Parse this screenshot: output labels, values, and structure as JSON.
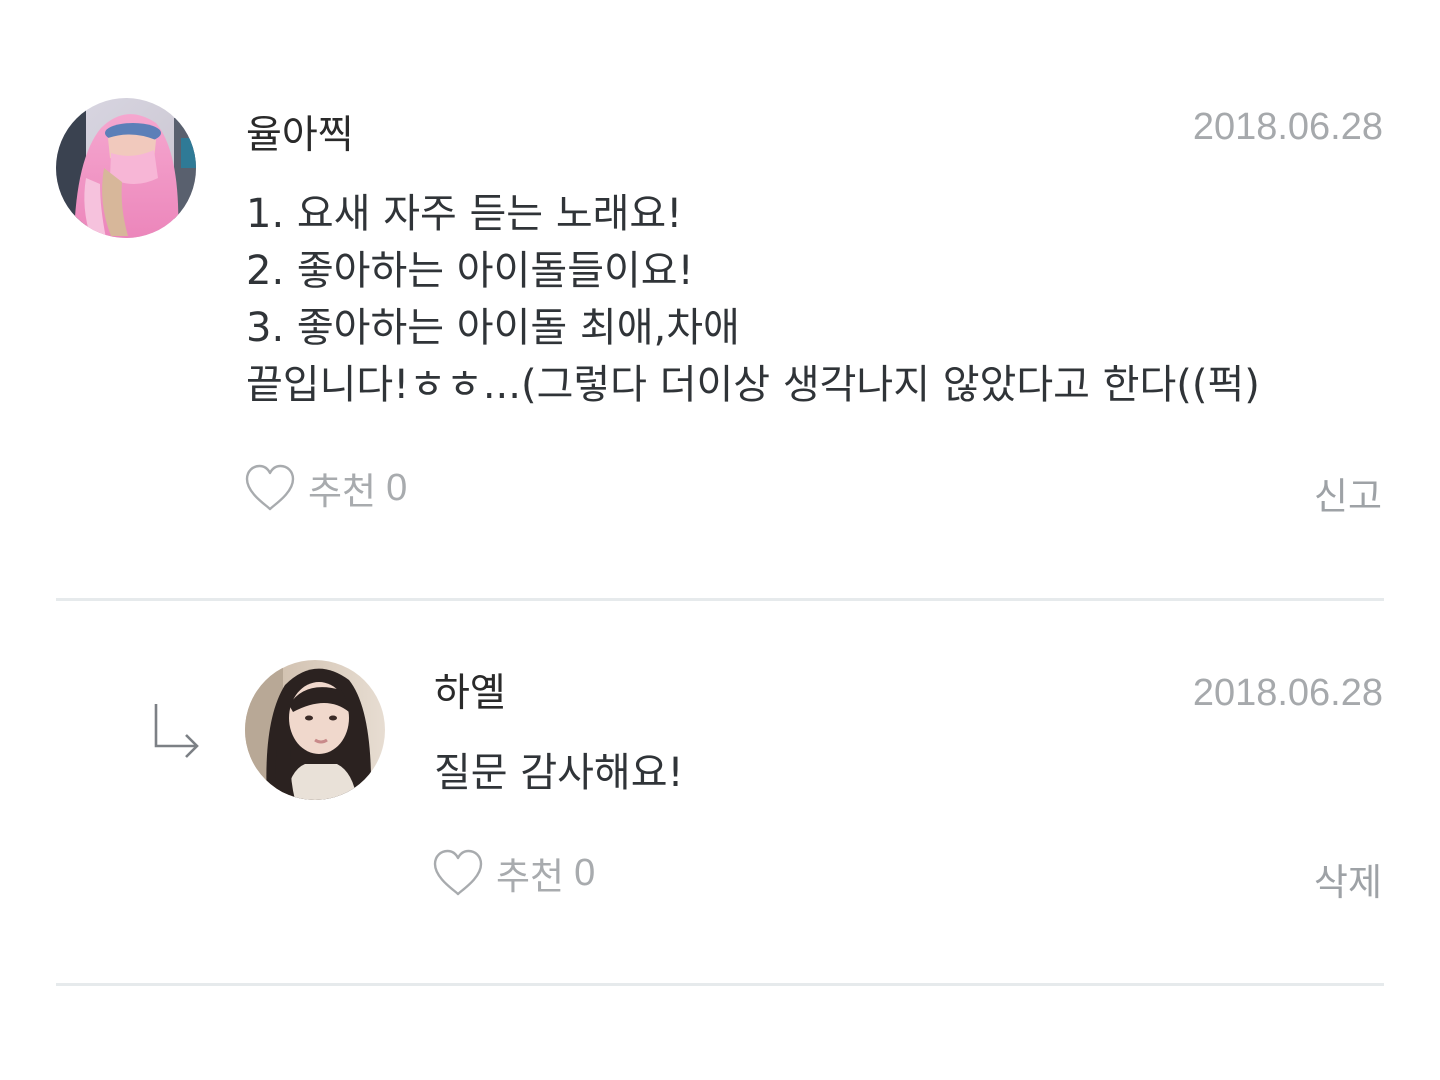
{
  "comments": [
    {
      "username": "율아찍",
      "date": "2018.06.28",
      "avatar": "pink-hoodie-avatar",
      "lines": [
        "1. 요새 자주 듣는 노래요!",
        "2. 좋아하는 아이돌들이요!",
        "3. 좋아하는 아이돌 최애,차애",
        "끝입니다!ㅎㅎ...(그렇다 더이상 생각나지 않았다고 한다((퍽)"
      ],
      "like_label": "추천",
      "like_count": "0",
      "action_label": "신고"
    },
    {
      "username": "하옐",
      "date": "2018.06.28",
      "avatar": "long-hair-portrait-avatar",
      "is_reply": true,
      "lines": [
        "질문 감사해요!"
      ],
      "like_label": "추천",
      "like_count": "0",
      "action_label": "삭제"
    }
  ],
  "icons": {
    "like": "heart-icon",
    "reply": "reply-arrow-icon"
  },
  "colors": {
    "text": "#303438",
    "muted": "#a8abae",
    "divider": "#e6eaec"
  }
}
